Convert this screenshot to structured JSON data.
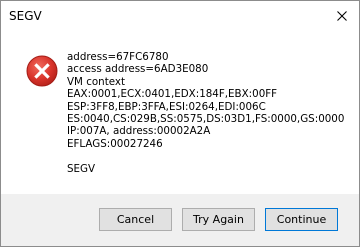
{
  "window": {
    "title": "SEGV"
  },
  "icons": {
    "error": "error-icon",
    "close": "close-icon"
  },
  "message": {
    "lines": [
      "address=67FC6780",
      "access address=6AD3E080",
      "VM context",
      "EAX:0001,ECX:0401,EDX:184F,EBX:00FF",
      "ESP:3FF8,EBP:3FFA,ESI:0264,EDI:006C",
      "ES:0040,CS:029B,SS:0575,DS:03D1,FS:0000,GS:0000",
      "IP:007A, address:00002A2A",
      "EFLAGS:00027246"
    ],
    "footer_text": "SEGV"
  },
  "buttons": {
    "cancel": "Cancel",
    "try_again": "Try Again",
    "continue": "Continue"
  },
  "colors": {
    "error_red": "#d9342b",
    "accent": "#0078d7",
    "footer_bg": "#f0f0f0"
  }
}
